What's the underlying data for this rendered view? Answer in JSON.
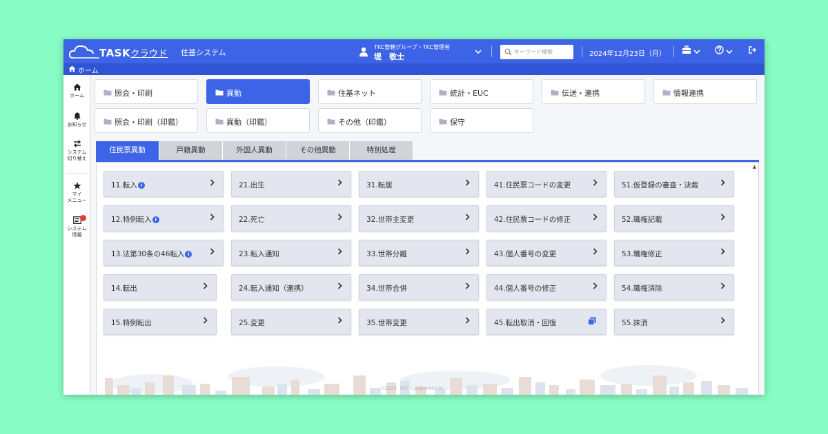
{
  "colors": {
    "background": "#87fcc4",
    "accent": "#3d64e6",
    "button": "#e3e6ee",
    "tab_inactive": "#d1d3d9",
    "badge": "#e53935"
  },
  "header": {
    "logo_main": "TASK",
    "logo_sub": "クラウド",
    "system_name": "住基システム",
    "user_org": "TKC管轄グループ・TKC管理者",
    "user_name": "堤　敬士",
    "search_placeholder": "キーワード検索",
    "date": "2024年12月23日（月）"
  },
  "breadcrumb": {
    "home": "ホーム"
  },
  "sidebar": {
    "items": [
      {
        "label": "ホーム",
        "icon": "home-icon"
      },
      {
        "label": "お知らせ",
        "icon": "bell-icon"
      },
      {
        "label_1": "システム",
        "label_2": "切り替え",
        "icon": "switch-icon"
      },
      {
        "label_1": "マイ",
        "label_2": "メニュー",
        "icon": "star-icon"
      },
      {
        "label_1": "システム",
        "label_2": "情報",
        "icon": "system-info-icon"
      }
    ]
  },
  "categories": [
    {
      "label": "照会・印刷",
      "active": false
    },
    {
      "label": "異動",
      "active": true
    },
    {
      "label": "住基ネット",
      "active": false
    },
    {
      "label": "統計・EUC",
      "active": false
    },
    {
      "label": "伝送・連携",
      "active": false
    },
    {
      "label": "情報連携",
      "active": false
    },
    {
      "label": "照会・印刷（印鑑）",
      "active": false
    },
    {
      "label": "異動（印鑑）",
      "active": false
    },
    {
      "label": "その他（印鑑）",
      "active": false
    },
    {
      "label": "保守",
      "active": false
    }
  ],
  "tabs": [
    {
      "label": "住民票異動",
      "active": true
    },
    {
      "label": "戸籍異動",
      "active": false
    },
    {
      "label": "外国人異動",
      "active": false
    },
    {
      "label": "その他異動",
      "active": false
    },
    {
      "label": "特別処理",
      "active": false
    }
  ],
  "menu": [
    [
      "11.転入",
      "12.特例転入",
      "13.法第30条の46転入",
      "14.転出",
      "15.特例転出"
    ],
    [
      "21.出生",
      "22.死亡",
      "23.転入通知",
      "24.転入通知（連携）",
      "25.変更"
    ],
    [
      "31.転居",
      "32.世帯主変更",
      "33.世帯分離",
      "34.世帯合併",
      "35.世帯変更"
    ],
    [
      "41.住民票コードの変更",
      "42.住民票コードの修正",
      "43.個人番号の変更",
      "44.個人番号の修正",
      "45.転出取消・回復"
    ],
    [
      "51.仮登録の審査・決裁",
      "52.職権記載",
      "53.職権修正",
      "54.職権消除",
      "55.抹消"
    ]
  ],
  "footer": "©2024 TKC Corporation."
}
